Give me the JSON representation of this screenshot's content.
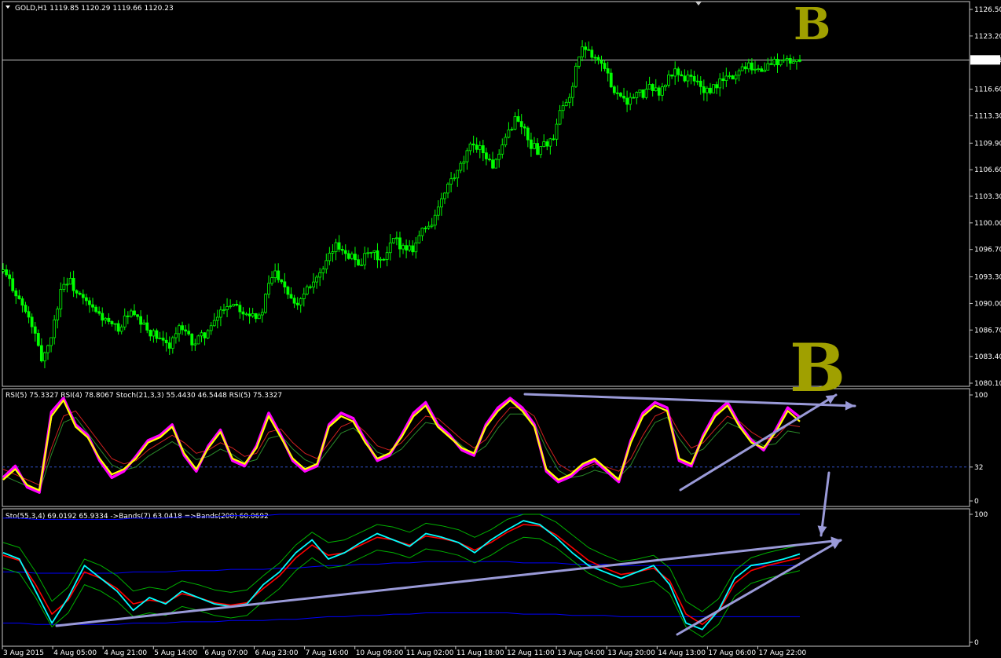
{
  "header": {
    "symbol_line": "GOLD,H1  1119.85 1120.29 1119.66 1120.23"
  },
  "rsi_panel": {
    "header": "RSI(5) 75.3327  RSI(4) 78.8067  Stoch(21,3,3) 55.4430 46.5448  RSI(5) 75.3327",
    "levels": [
      "100",
      "32",
      "0"
    ]
  },
  "sto_panel": {
    "header": "Sto(55,3,4) 69.0192 65.9334  ->Bands(7) 63.0418  =>Bands(200) 60.0692",
    "levels": [
      "100",
      "0"
    ]
  },
  "annotations": {
    "b_top": "B",
    "b_mid": "B"
  },
  "colors": {
    "candle": "#00ff00",
    "rsi_main": "#ffff00",
    "rsi_shadow": "#ff00ff",
    "sto_cyan": "#00ffff",
    "sto_red": "#ff0000",
    "band_green": "#00b000",
    "band_blue": "#0000ff",
    "trendline": "#9a9ad8",
    "annotation": "#a0a000"
  },
  "chart_data": [
    {
      "type": "candlestick",
      "title": "GOLD,H1",
      "y_axis_ticks": [
        "1126.50",
        "1123.20",
        "1120.23",
        "1116.60",
        "1113.30",
        "1109.90",
        "1106.60",
        "1103.30",
        "1100.00",
        "1096.70",
        "1093.30",
        "1090.00",
        "1086.70",
        "1083.40",
        "1080.10"
      ],
      "ylim": [
        1080.1,
        1126.5
      ],
      "current_price": 1120.23,
      "x_axis_ticks": [
        "3 Aug 2015",
        "4 Aug 05:00",
        "4 Aug 21:00",
        "5 Aug 14:00",
        "6 Aug 07:00",
        "6 Aug 23:00",
        "7 Aug 16:00",
        "10 Aug 09:00",
        "11 Aug 02:00",
        "11 Aug 18:00",
        "12 Aug 11:00",
        "13 Aug 04:00",
        "13 Aug 20:00",
        "14 Aug 13:00",
        "17 Aug 06:00",
        "17 Aug 22:00"
      ],
      "close_path": [
        [
          0,
          1094
        ],
        [
          10,
          1092
        ],
        [
          22,
          1089
        ],
        [
          30,
          1087
        ],
        [
          38,
          1083
        ],
        [
          46,
          1085
        ],
        [
          52,
          1088
        ],
        [
          58,
          1092
        ],
        [
          66,
          1093
        ],
        [
          75,
          1091
        ],
        [
          84,
          1090
        ],
        [
          92,
          1089
        ],
        [
          102,
          1088
        ],
        [
          110,
          1087
        ],
        [
          118,
          1087
        ],
        [
          126,
          1089
        ],
        [
          134,
          1088
        ],
        [
          142,
          1087
        ],
        [
          152,
          1086
        ],
        [
          160,
          1085
        ],
        [
          168,
          1085
        ],
        [
          176,
          1087
        ],
        [
          184,
          1086
        ],
        [
          192,
          1085
        ],
        [
          200,
          1086
        ],
        [
          210,
          1087
        ],
        [
          218,
          1089
        ],
        [
          226,
          1090
        ],
        [
          234,
          1090
        ],
        [
          242,
          1089
        ],
        [
          250,
          1089
        ],
        [
          258,
          1088
        ],
        [
          266,
          1092
        ],
        [
          272,
          1094
        ],
        [
          280,
          1093
        ],
        [
          288,
          1091
        ],
        [
          296,
          1090
        ],
        [
          304,
          1092
        ],
        [
          312,
          1093
        ],
        [
          322,
          1094
        ],
        [
          332,
          1097
        ],
        [
          340,
          1097
        ],
        [
          348,
          1096
        ],
        [
          358,
          1095
        ],
        [
          366,
          1096
        ],
        [
          374,
          1096
        ],
        [
          382,
          1095
        ],
        [
          392,
          1098
        ],
        [
          402,
          1097
        ],
        [
          412,
          1097
        ],
        [
          420,
          1099
        ],
        [
          430,
          1100
        ],
        [
          438,
          1102
        ],
        [
          448,
          1105
        ],
        [
          456,
          1106
        ],
        [
          464,
          1108
        ],
        [
          472,
          1110
        ],
        [
          482,
          1109
        ],
        [
          490,
          1107
        ],
        [
          498,
          1108
        ],
        [
          506,
          1111
        ],
        [
          514,
          1113
        ],
        [
          522,
          1112
        ],
        [
          528,
          1110
        ],
        [
          536,
          1109
        ],
        [
          544,
          1110
        ],
        [
          552,
          1110
        ],
        [
          560,
          1114
        ],
        [
          568,
          1115
        ],
        [
          576,
          1120
        ],
        [
          584,
          1122
        ],
        [
          592,
          1121
        ],
        [
          600,
          1120
        ],
        [
          608,
          1118
        ],
        [
          616,
          1116
        ],
        [
          622,
          1116
        ],
        [
          628,
          1115
        ],
        [
          636,
          1116
        ],
        [
          644,
          1116
        ],
        [
          652,
          1117
        ],
        [
          660,
          1116
        ],
        [
          668,
          1118
        ],
        [
          676,
          1119
        ],
        [
          684,
          1118
        ],
        [
          692,
          1118
        ],
        [
          700,
          1117
        ],
        [
          708,
          1116
        ],
        [
          716,
          1117
        ],
        [
          724,
          1118
        ],
        [
          732,
          1118
        ],
        [
          740,
          1119
        ],
        [
          748,
          1120
        ],
        [
          756,
          1119
        ],
        [
          764,
          1119
        ],
        [
          772,
          1120
        ],
        [
          780,
          1120
        ],
        [
          790,
          1120
        ],
        [
          800,
          1120.23
        ]
      ]
    },
    {
      "type": "line",
      "title": "RSI(5) / RSI(4) / Stoch(21,3,3)",
      "ylim": [
        0,
        100
      ],
      "y_axis_ticks": [
        "100",
        "32",
        "0"
      ],
      "series": [
        {
          "name": "RSI(5)",
          "values": [
            20,
            30,
            15,
            10,
            80,
            95,
            70,
            60,
            40,
            25,
            30,
            40,
            55,
            60,
            70,
            45,
            30,
            50,
            65,
            40,
            35,
            50,
            80,
            60,
            40,
            30,
            35,
            70,
            80,
            75,
            55,
            40,
            45,
            60,
            80,
            90,
            70,
            60,
            50,
            45,
            70,
            85,
            95,
            85,
            70,
            30,
            20,
            25,
            35,
            40,
            30,
            20,
            55,
            80,
            90,
            85,
            40,
            35,
            60,
            80,
            90,
            70,
            55,
            50,
            65,
            85,
            75
          ]
        },
        {
          "name": "RSI(4)",
          "values": [
            22,
            33,
            13,
            8,
            84,
            97,
            72,
            62,
            38,
            22,
            28,
            42,
            57,
            62,
            72,
            43,
            28,
            52,
            67,
            38,
            33,
            52,
            83,
            62,
            38,
            28,
            33,
            72,
            83,
            78,
            57,
            38,
            43,
            62,
            83,
            93,
            72,
            62,
            48,
            43,
            72,
            88,
            97,
            88,
            72,
            28,
            18,
            23,
            33,
            38,
            28,
            18,
            57,
            83,
            93,
            88,
            38,
            33,
            62,
            83,
            93,
            72,
            57,
            48,
            67,
            88,
            79
          ]
        },
        {
          "name": "Stoch(21,3,3)",
          "values": [
            30,
            25,
            20,
            15,
            50,
            80,
            85,
            70,
            55,
            40,
            35,
            38,
            48,
            55,
            62,
            55,
            45,
            48,
            55,
            50,
            42,
            45,
            65,
            68,
            55,
            45,
            40,
            55,
            70,
            75,
            65,
            52,
            48,
            55,
            68,
            80,
            78,
            68,
            58,
            50,
            58,
            75,
            88,
            88,
            80,
            55,
            35,
            28,
            30,
            35,
            32,
            28,
            40,
            62,
            80,
            85,
            65,
            50,
            55,
            68,
            80,
            75,
            65,
            58,
            60,
            72,
            70
          ]
        }
      ]
    },
    {
      "type": "line",
      "title": "Sto(55,3,4) with Bands(7) and Bands(200)",
      "ylim": [
        0,
        100
      ],
      "y_axis_ticks": [
        "100",
        "0"
      ],
      "series": [
        {
          "name": "Sto(55,3,4)",
          "values": [
            70,
            65,
            40,
            15,
            35,
            60,
            50,
            40,
            25,
            35,
            30,
            40,
            35,
            30,
            28,
            30,
            45,
            55,
            70,
            80,
            65,
            70,
            78,
            85,
            80,
            75,
            85,
            82,
            78,
            70,
            80,
            88,
            95,
            92,
            82,
            70,
            60,
            55,
            50,
            55,
            60,
            45,
            15,
            10,
            25,
            50,
            60,
            62,
            65,
            69
          ]
        },
        {
          "name": "Bands(7)",
          "values": [
            68,
            64,
            45,
            22,
            33,
            55,
            50,
            42,
            30,
            33,
            31,
            38,
            35,
            31,
            29,
            31,
            42,
            52,
            66,
            76,
            68,
            70,
            76,
            82,
            80,
            76,
            83,
            81,
            78,
            72,
            78,
            86,
            92,
            91,
            84,
            74,
            64,
            58,
            53,
            55,
            58,
            48,
            22,
            14,
            24,
            46,
            56,
            60,
            63,
            66
          ]
        },
        {
          "name": "Bands(200)",
          "values": [
            55,
            55,
            54,
            54,
            54,
            54,
            54,
            54,
            55,
            55,
            55,
            56,
            56,
            56,
            57,
            57,
            57,
            58,
            58,
            59,
            60,
            60,
            61,
            61,
            62,
            62,
            63,
            63,
            63,
            63,
            63,
            63,
            62,
            62,
            62,
            61,
            61,
            61,
            60,
            60,
            60,
            60,
            60,
            60,
            60,
            60,
            60,
            60,
            60,
            60
          ]
        }
      ]
    }
  ]
}
